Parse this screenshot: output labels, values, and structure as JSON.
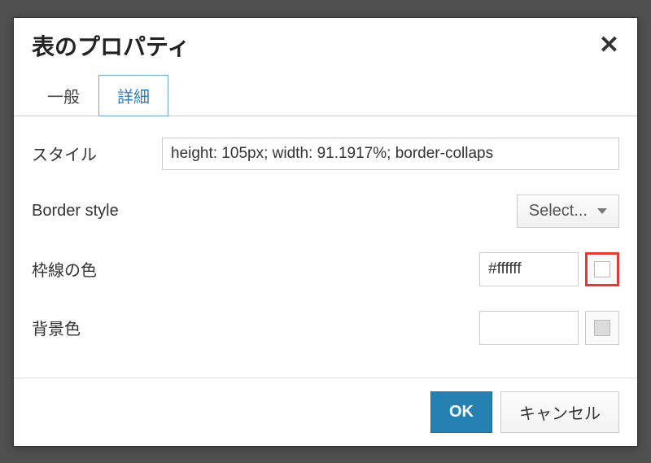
{
  "dialog": {
    "title": "表のプロパティ"
  },
  "tabs": {
    "general": "一般",
    "advanced": "詳細"
  },
  "fields": {
    "style": {
      "label": "スタイル",
      "value": "height: 105px; width: 91.1917%; border-collaps"
    },
    "border_style": {
      "label": "Border style",
      "value": "Select..."
    },
    "border_color": {
      "label": "枠線の色",
      "value": "#ffffff"
    },
    "background_color": {
      "label": "背景色",
      "value": ""
    }
  },
  "buttons": {
    "ok": "OK",
    "cancel": "キャンセル"
  }
}
